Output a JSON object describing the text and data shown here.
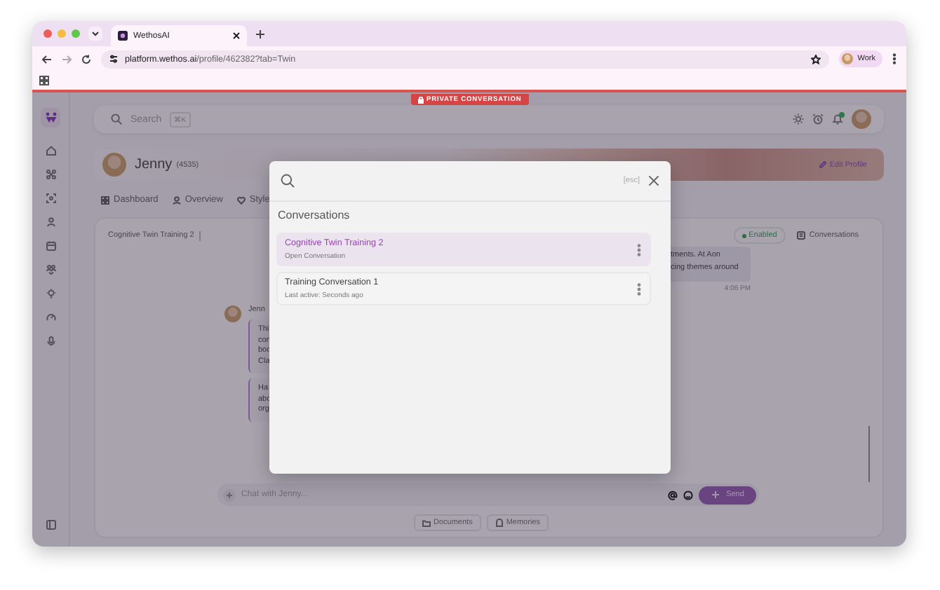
{
  "browser": {
    "tab_title": "WethosAI",
    "url_host": "platform.wethos.ai",
    "url_path": "/profile/462382?tab=Twin",
    "profile": "Work"
  },
  "badge": {
    "label": "PRIVATE CONVERSATION"
  },
  "header": {
    "search_placeholder": "Search",
    "shortcut": "⌘K"
  },
  "profile": {
    "name": "Jenny",
    "number": "(4535)",
    "edit": "Edit Profile"
  },
  "tabs": [
    {
      "label": "Dashboard",
      "selected": false
    },
    {
      "label": "Overview",
      "selected": false
    },
    {
      "label": "Style",
      "selected": false
    }
  ],
  "chat": {
    "title": "Cognitive Twin Training 2",
    "status": "Enabled",
    "conversations_button": "Conversations",
    "reply": {
      "lines": [
        "tments. At Aon",
        "cing themes around"
      ],
      "time": "4:06 PM"
    },
    "sender": "Jenn",
    "messages": [
      {
        "lines": [
          "Thi",
          "con",
          "boo",
          "Cla"
        ]
      },
      {
        "lines": [
          "Ha",
          "abo",
          "org"
        ]
      }
    ],
    "input_placeholder": "Chat with Jenny...",
    "send": "Send",
    "chips": [
      "Documents",
      "Memories"
    ]
  },
  "modal": {
    "esc": "[esc]",
    "heading": "Conversations",
    "items": [
      {
        "title": "Cognitive Twin Training 2",
        "subtitle": "Open Conversation",
        "selected": true
      },
      {
        "title": "Training Conversation 1",
        "subtitle": "Last active: Seconds ago",
        "selected": false
      }
    ]
  }
}
